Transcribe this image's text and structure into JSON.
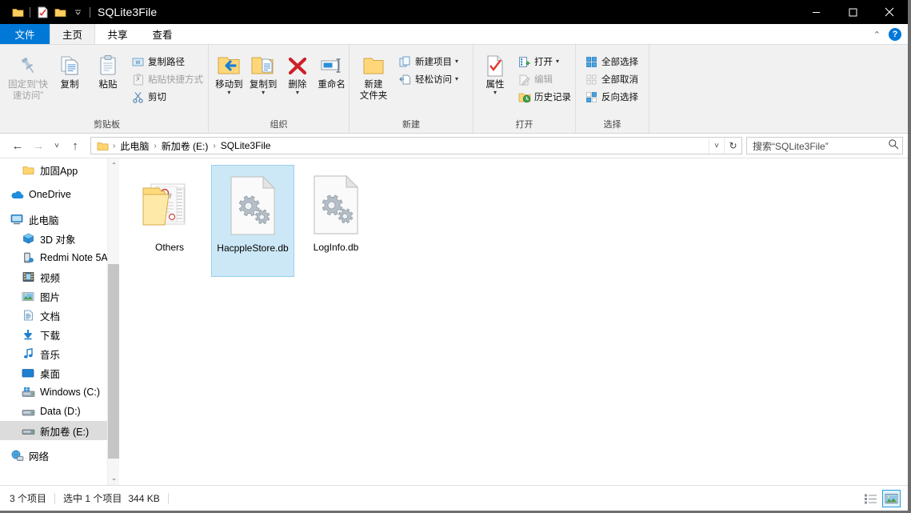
{
  "window": {
    "title": "SQLite3File",
    "quick_access": [
      {
        "name": "folder-icon",
        "label": "文件夹"
      },
      {
        "name": "properties-icon",
        "label": "属性"
      },
      {
        "name": "new-folder-icon",
        "label": "新建文件夹"
      },
      {
        "name": "chevron-down-icon",
        "label": "自定义快速访问工具栏"
      }
    ],
    "controls": {
      "minimize": "—",
      "maximize": "□",
      "close": "✕"
    }
  },
  "tabs": [
    {
      "label": "文件",
      "kind": "file"
    },
    {
      "label": "主页",
      "kind": "active"
    },
    {
      "label": "共享",
      "kind": "normal"
    },
    {
      "label": "查看",
      "kind": "normal"
    }
  ],
  "tabs_right": {
    "collapse": "⌃",
    "help": "?"
  },
  "ribbon": {
    "groups": [
      {
        "label": "剪贴板",
        "big": [
          {
            "label": "固定到“快\n速访问”",
            "icon": "pin-icon",
            "disabled": false
          },
          {
            "label": "复制",
            "icon": "copy-icon",
            "disabled": false
          },
          {
            "label": "粘贴",
            "icon": "paste-icon",
            "disabled": false
          }
        ],
        "small": [
          {
            "label": "复制路径",
            "icon": "copy-path-icon",
            "disabled": false
          },
          {
            "label": "粘贴快捷方式",
            "icon": "paste-shortcut-icon",
            "disabled": true
          },
          {
            "label": "剪切",
            "icon": "cut-icon",
            "disabled": false
          }
        ]
      },
      {
        "label": "组织",
        "big": [
          {
            "label": "移动到",
            "icon": "move-to-icon",
            "caret": true
          },
          {
            "label": "复制到",
            "icon": "copy-to-icon",
            "caret": true
          },
          {
            "label": "删除",
            "icon": "delete-icon",
            "caret": true
          },
          {
            "label": "重命名",
            "icon": "rename-icon",
            "caret": false
          }
        ],
        "small": []
      },
      {
        "label": "新建",
        "big": [
          {
            "label": "新建\n文件夹",
            "icon": "new-folder-icon",
            "caret": false
          }
        ],
        "small": [
          {
            "label": "新建项目",
            "icon": "new-item-icon",
            "caret": true
          },
          {
            "label": "轻松访问",
            "icon": "easy-access-icon",
            "caret": true
          }
        ]
      },
      {
        "label": "打开",
        "big": [
          {
            "label": "属性",
            "icon": "properties-icon",
            "caret": true
          }
        ],
        "small": [
          {
            "label": "打开",
            "icon": "open-icon",
            "caret": true,
            "disabled": false
          },
          {
            "label": "编辑",
            "icon": "edit-icon",
            "disabled": true
          },
          {
            "label": "历史记录",
            "icon": "history-icon",
            "disabled": false
          }
        ]
      },
      {
        "label": "选择",
        "big": [],
        "small": [
          {
            "label": "全部选择",
            "icon": "select-all-icon",
            "disabled": false
          },
          {
            "label": "全部取消",
            "icon": "select-none-icon",
            "disabled": false
          },
          {
            "label": "反向选择",
            "icon": "invert-selection-icon",
            "disabled": false
          }
        ]
      }
    ]
  },
  "address": {
    "back": "←",
    "forward": "→",
    "recent": "˅",
    "up": "↑",
    "crumbs": [
      "此电脑",
      "新加卷 (E:)",
      "SQLite3File"
    ],
    "separator": "›",
    "dropdown": "˅",
    "refresh": "↻"
  },
  "search": {
    "placeholder": "搜索“SQLite3File”",
    "icon": "search-icon"
  },
  "sidebar": {
    "items": [
      {
        "label": "加固App",
        "icon": "folder-icon",
        "indent": 1,
        "selected": false
      },
      {
        "label": "OneDrive",
        "icon": "onedrive-icon",
        "indent": 0,
        "selected": false,
        "gap_before": true
      },
      {
        "label": "此电脑",
        "icon": "this-pc-icon",
        "indent": 0,
        "selected": false,
        "gap_before": true
      },
      {
        "label": "3D 对象",
        "icon": "3d-objects-icon",
        "indent": 1,
        "selected": false
      },
      {
        "label": "Redmi Note 5A",
        "icon": "phone-icon",
        "indent": 1,
        "selected": false
      },
      {
        "label": "视频",
        "icon": "videos-icon",
        "indent": 1,
        "selected": false
      },
      {
        "label": "图片",
        "icon": "pictures-icon",
        "indent": 1,
        "selected": false
      },
      {
        "label": "文档",
        "icon": "documents-icon",
        "indent": 1,
        "selected": false
      },
      {
        "label": "下载",
        "icon": "downloads-icon",
        "indent": 1,
        "selected": false
      },
      {
        "label": "音乐",
        "icon": "music-icon",
        "indent": 1,
        "selected": false
      },
      {
        "label": "桌面",
        "icon": "desktop-icon",
        "indent": 1,
        "selected": false
      },
      {
        "label": "Windows (C:)",
        "icon": "windows-drive-icon",
        "indent": 1,
        "selected": false
      },
      {
        "label": "Data (D:)",
        "icon": "drive-icon",
        "indent": 1,
        "selected": false
      },
      {
        "label": "新加卷 (E:)",
        "icon": "drive-icon",
        "indent": 1,
        "selected": true
      },
      {
        "label": "网络",
        "icon": "network-icon",
        "indent": 0,
        "selected": false,
        "gap_before": true
      }
    ],
    "scrollbar": {
      "up": "⌃",
      "down": "⌄"
    }
  },
  "files": [
    {
      "name": "Others",
      "type": "folder",
      "selected": false
    },
    {
      "name": "HacppleStore.db",
      "type": "db-file",
      "selected": true
    },
    {
      "name": "LogInfo.db",
      "type": "db-file",
      "selected": false
    }
  ],
  "status": {
    "count": "3 个项目",
    "selection": "选中 1 个项目",
    "size": "344 KB",
    "views": [
      {
        "name": "details-view-button",
        "active": false
      },
      {
        "name": "large-icons-view-button",
        "active": true
      }
    ]
  },
  "colors": {
    "accent": "#0078d7",
    "selection_fill": "#cce8f7",
    "selection_border": "#99d1f0",
    "titlebar": "#000000",
    "ribbon_bg": "#f1f1f1",
    "folder_yellow": "#ffd76e"
  }
}
